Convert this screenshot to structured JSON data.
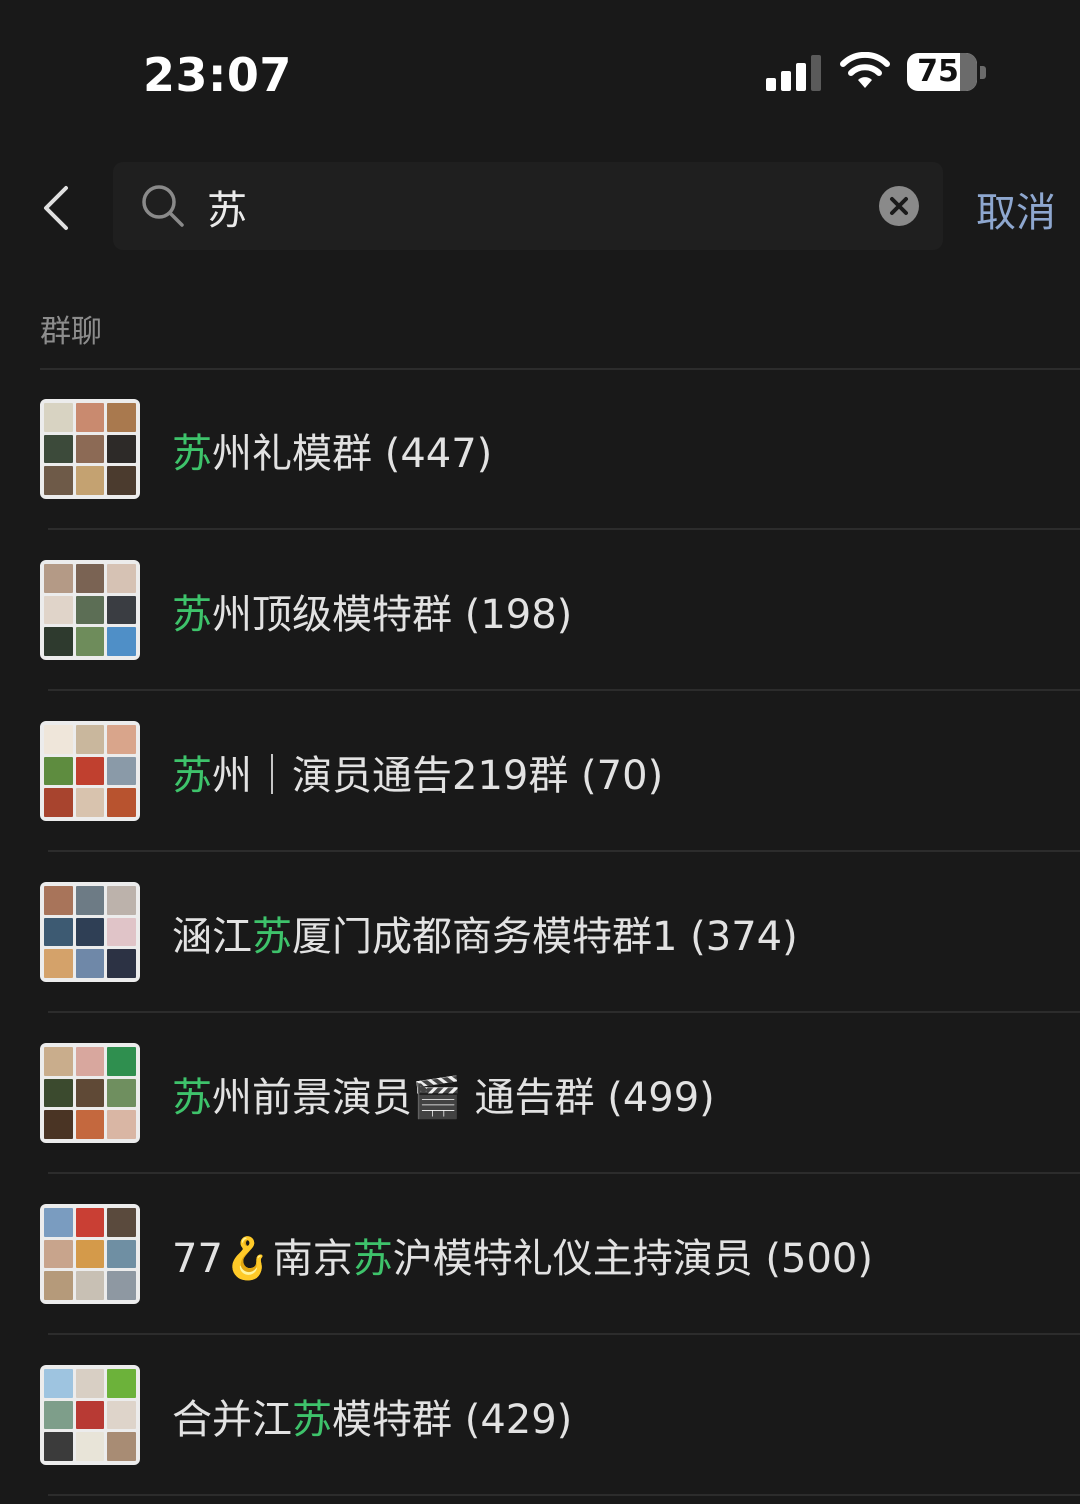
{
  "status_bar": {
    "time": "23:07",
    "battery_level": "75",
    "battery_fraction": 0.75,
    "signal_bars": 3
  },
  "search": {
    "query": "苏",
    "cancel_label": "取消"
  },
  "section": {
    "title": "群聊"
  },
  "highlight_color": "#3ec36b",
  "results": [
    {
      "pre": "",
      "hl": "苏",
      "post": "州礼模群 (447)",
      "colors": [
        "#d8d3c2",
        "#c98a6f",
        "#a9794e",
        "#3c4a3a",
        "#8c6a55",
        "#2d2a28",
        "#6e5a48",
        "#c4a271",
        "#4b3b2e"
      ]
    },
    {
      "pre": "",
      "hl": "苏",
      "post": "州顶级模特群 (198)",
      "colors": [
        "#b49a86",
        "#7a6353",
        "#d6c2b4",
        "#e0d4c9",
        "#5c6e55",
        "#3a3d42",
        "#2e3a2e",
        "#6e8c5b",
        "#4f8fc7"
      ]
    },
    {
      "pre": "",
      "hl": "苏",
      "post": "州｜演员通告219群 (70)",
      "colors": [
        "#efe6da",
        "#c9b79d",
        "#d9a58b",
        "#5e8c3f",
        "#c0402f",
        "#8a9aa8",
        "#a8442e",
        "#d8c3ae",
        "#b8532f"
      ]
    },
    {
      "pre": "涵江",
      "hl": "苏",
      "post": "厦门成都商务模特群1 (374)",
      "colors": [
        "#a8745a",
        "#6d7b85",
        "#bcb2ab",
        "#3d5a72",
        "#2f3f55",
        "#e0c4c8",
        "#d4a26a",
        "#6f88a8",
        "#2c3244"
      ]
    },
    {
      "pre": "",
      "hl": "苏",
      "post": "州前景演员🎬 通告群 (499)",
      "colors": [
        "#c9ad8c",
        "#d8a79e",
        "#2f8f4f",
        "#3b4a2e",
        "#5f4936",
        "#6f8f5f",
        "#4a3424",
        "#c4683e",
        "#d9b6a4"
      ]
    },
    {
      "pre": "77🪝南京",
      "hl": "苏",
      "post": "沪模特礼仪主持演员 (500)",
      "colors": [
        "#7a9cc0",
        "#c93f34",
        "#5a4a3d",
        "#c8a48c",
        "#d49a4a",
        "#6f8fa3",
        "#b59a7a",
        "#c8c0b4",
        "#8e98a2"
      ]
    },
    {
      "pre": "合并江",
      "hl": "苏",
      "post": "模特群 (429)",
      "colors": [
        "#9ec4e0",
        "#d8cfc4",
        "#6cb23a",
        "#7e9e8a",
        "#b83a34",
        "#ded4ca",
        "#3b3b3b",
        "#e8e4d8",
        "#a88c74"
      ]
    }
  ]
}
